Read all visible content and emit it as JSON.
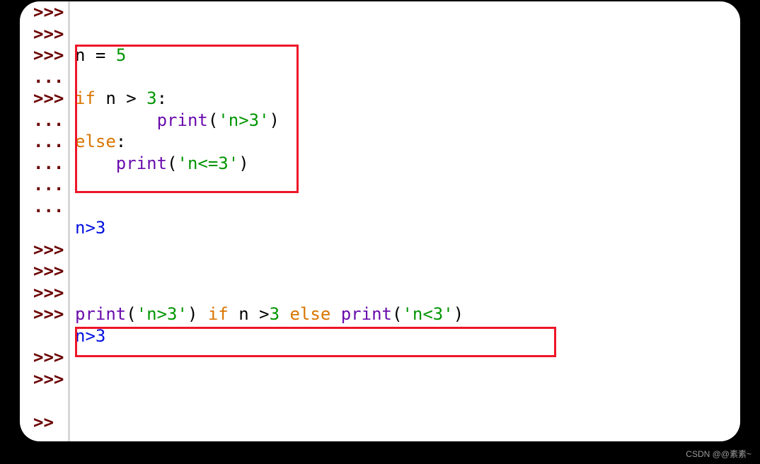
{
  "prompts": {
    "primary": ">>>",
    "continuation": "..."
  },
  "lines": [
    {
      "prompt": ">>>",
      "segments": []
    },
    {
      "prompt": ">>>",
      "segments": []
    },
    {
      "prompt": ">>>",
      "segments": [
        {
          "t": "n ",
          "c": "tok-ident"
        },
        {
          "t": "= ",
          "c": "tok-op"
        },
        {
          "t": "5",
          "c": "tok-num"
        }
      ]
    },
    {
      "prompt": "...",
      "segments": []
    },
    {
      "prompt": ">>>",
      "segments": [
        {
          "t": "if ",
          "c": "tok-kw"
        },
        {
          "t": "n ",
          "c": "tok-ident"
        },
        {
          "t": "> ",
          "c": "tok-op"
        },
        {
          "t": "3",
          "c": "tok-num"
        },
        {
          "t": ":",
          "c": "tok-op"
        }
      ]
    },
    {
      "prompt": "...",
      "segments": [
        {
          "t": "        ",
          "c": "tok-ident"
        },
        {
          "t": "print",
          "c": "tok-func"
        },
        {
          "t": "(",
          "c": "tok-op"
        },
        {
          "t": "'n>3'",
          "c": "tok-str"
        },
        {
          "t": ")",
          "c": "tok-op"
        }
      ]
    },
    {
      "prompt": "...",
      "segments": [
        {
          "t": "else",
          "c": "tok-kw"
        },
        {
          "t": ":",
          "c": "tok-op"
        }
      ]
    },
    {
      "prompt": "...",
      "segments": [
        {
          "t": "    ",
          "c": "tok-ident"
        },
        {
          "t": "print",
          "c": "tok-func"
        },
        {
          "t": "(",
          "c": "tok-op"
        },
        {
          "t": "'n<=3'",
          "c": "tok-str"
        },
        {
          "t": ")",
          "c": "tok-op"
        }
      ]
    },
    {
      "prompt": "...",
      "segments": []
    },
    {
      "prompt": "...",
      "segments": []
    },
    {
      "prompt": "",
      "segments": [
        {
          "t": "n>3",
          "c": "tok-output"
        }
      ]
    },
    {
      "prompt": ">>>",
      "segments": []
    },
    {
      "prompt": ">>>",
      "segments": []
    },
    {
      "prompt": ">>>",
      "segments": []
    },
    {
      "prompt": ">>>",
      "segments": [
        {
          "t": "print",
          "c": "tok-func"
        },
        {
          "t": "(",
          "c": "tok-op"
        },
        {
          "t": "'n>3'",
          "c": "tok-str"
        },
        {
          "t": ") ",
          "c": "tok-op"
        },
        {
          "t": "if ",
          "c": "tok-kw"
        },
        {
          "t": "n ",
          "c": "tok-ident"
        },
        {
          "t": ">",
          "c": "tok-op"
        },
        {
          "t": "3 ",
          "c": "tok-num"
        },
        {
          "t": "else ",
          "c": "tok-kw"
        },
        {
          "t": "print",
          "c": "tok-func"
        },
        {
          "t": "(",
          "c": "tok-op"
        },
        {
          "t": "'n<3'",
          "c": "tok-str"
        },
        {
          "t": ")",
          "c": "tok-op"
        }
      ]
    },
    {
      "prompt": "",
      "segments": [
        {
          "t": "n>3",
          "c": "tok-output"
        }
      ]
    },
    {
      "prompt": ">>>",
      "segments": []
    },
    {
      "prompt": ">>>",
      "segments": []
    },
    {
      "prompt": "",
      "segments": []
    },
    {
      "prompt": ">>",
      "segments": []
    }
  ],
  "watermark": "CSDN @@素素~"
}
